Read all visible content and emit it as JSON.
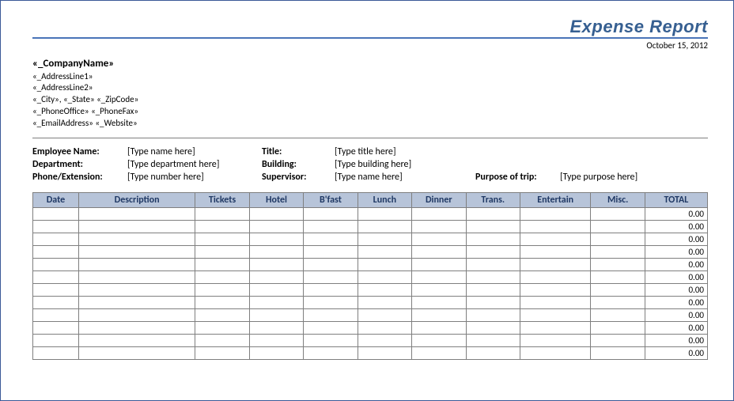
{
  "header": {
    "title": "Expense Report",
    "date": "October 15, 2012"
  },
  "company": {
    "name": "«_CompanyName»",
    "address1": "«_AddressLine1»",
    "address2": "«_AddressLine2»",
    "city": "«_City»",
    "state": "«_State»",
    "zip": "«_ZipCode»",
    "phone_office": "«_PhoneOffice»",
    "phone_fax": "«_PhoneFax»",
    "email": "«_EmailAddress»",
    "website": "«_Website»"
  },
  "fields": {
    "employee_name_label": "Employee Name:",
    "employee_name_value": "[Type name here]",
    "department_label": "Department:",
    "department_value": "[Type department here]",
    "phone_label": "Phone/Extension:",
    "phone_value": "[Type number here]",
    "title_label": "Title:",
    "title_value": "[Type title here]",
    "building_label": "Building:",
    "building_value": "[Type building here]",
    "supervisor_label": "Supervisor:",
    "supervisor_value": "[Type name here]",
    "purpose_label": "Purpose of trip:",
    "purpose_value": "[Type purpose here]"
  },
  "table": {
    "headers": {
      "date": "Date",
      "description": "Description",
      "tickets": "Tickets",
      "hotel": "Hotel",
      "bfast": "B'fast",
      "lunch": "Lunch",
      "dinner": "Dinner",
      "trans": "Trans.",
      "entertain": "Entertain",
      "misc": "Misc.",
      "total": "TOTAL"
    },
    "rows": [
      {
        "total": "0.00"
      },
      {
        "total": "0.00"
      },
      {
        "total": "0.00"
      },
      {
        "total": "0.00"
      },
      {
        "total": "0.00"
      },
      {
        "total": "0.00"
      },
      {
        "total": "0.00"
      },
      {
        "total": "0.00"
      },
      {
        "total": "0.00"
      },
      {
        "total": "0.00"
      },
      {
        "total": "0.00"
      },
      {
        "total": "0.00"
      }
    ]
  }
}
